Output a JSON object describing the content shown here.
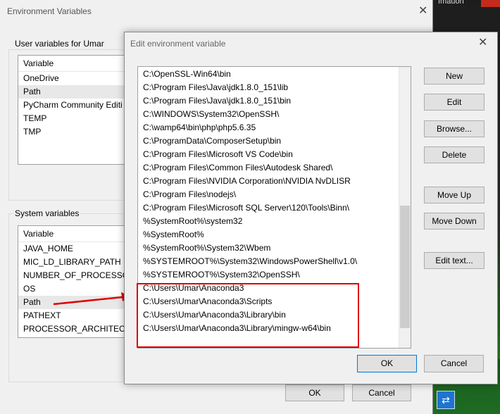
{
  "background_window": {
    "title": "Environment Variables",
    "user_group_label": "User variables for Umar",
    "user_list": {
      "header": "Variable",
      "rows": [
        "OneDrive",
        "Path",
        "PyCharm Community Editi",
        "TEMP",
        "TMP"
      ],
      "selected": 1
    },
    "system_group_label": "System variables",
    "system_list": {
      "header": "Variable",
      "rows": [
        "JAVA_HOME",
        "MIC_LD_LIBRARY_PATH",
        "NUMBER_OF_PROCESSORS",
        "OS",
        "Path",
        "PATHEXT",
        "PROCESSOR_ARCHITECTUR"
      ],
      "selected": 4
    },
    "ok_label": "OK",
    "cancel_label": "Cancel"
  },
  "dialog": {
    "title": "Edit environment variable",
    "paths": [
      "C:\\OpenSSL-Win64\\bin",
      "C:\\Program Files\\Java\\jdk1.8.0_151\\lib",
      "C:\\Program Files\\Java\\jdk1.8.0_151\\bin",
      "C:\\WINDOWS\\System32\\OpenSSH\\",
      "C:\\wamp64\\bin\\php\\php5.6.35",
      "C:\\ProgramData\\ComposerSetup\\bin",
      "C:\\Program Files\\Microsoft VS Code\\bin",
      "C:\\Program Files\\Common Files\\Autodesk Shared\\",
      "C:\\Program Files\\NVIDIA Corporation\\NVIDIA NvDLISR",
      "C:\\Program Files\\nodejs\\",
      "C:\\Program Files\\Microsoft SQL Server\\120\\Tools\\Binn\\",
      "%SystemRoot%\\system32",
      "%SystemRoot%",
      "%SystemRoot%\\System32\\Wbem",
      "%SYSTEMROOT%\\System32\\WindowsPowerShell\\v1.0\\",
      "%SYSTEMROOT%\\System32\\OpenSSH\\",
      "C:\\Users\\Umar\\Anaconda3",
      "C:\\Users\\Umar\\Anaconda3\\Scripts",
      "C:\\Users\\Umar\\Anaconda3\\Library\\bin",
      "C:\\Users\\Umar\\Anaconda3\\Library\\mingw-w64\\bin"
    ],
    "buttons": {
      "new": "New",
      "edit": "Edit",
      "browse": "Browse...",
      "delete": "Delete",
      "move_up": "Move Up",
      "move_down": "Move Down",
      "edit_text": "Edit text..."
    },
    "ok_label": "OK",
    "cancel_label": "Cancel"
  },
  "colors": {
    "annotation": "#e00000",
    "dialog_bg": "#f0f0f0",
    "selection": "#e8e8e8"
  }
}
